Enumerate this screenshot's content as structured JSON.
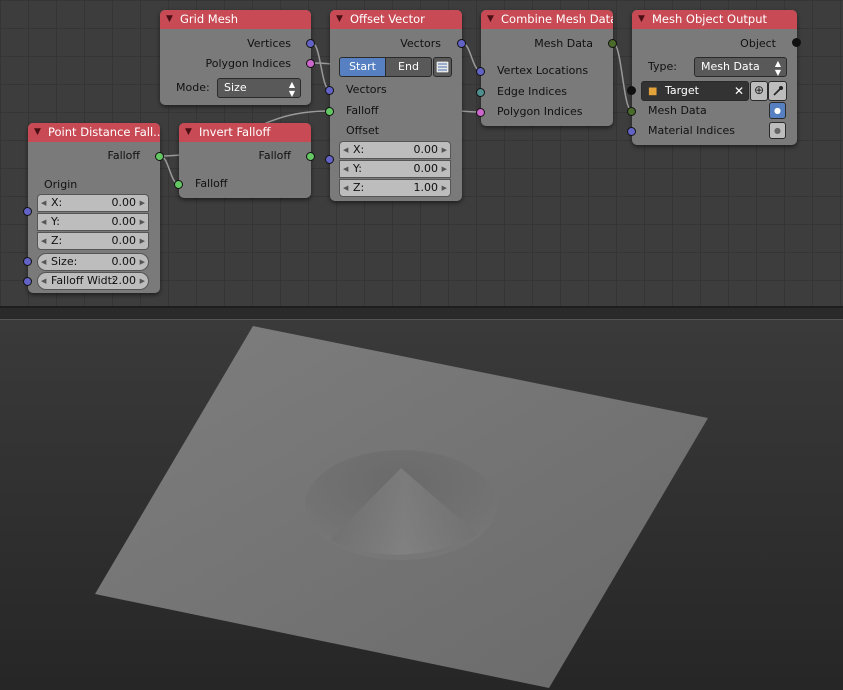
{
  "nodes": {
    "grid_mesh": {
      "title": "Grid Mesh",
      "outputs": [
        "Vertices",
        "Polygon Indices"
      ],
      "mode_label": "Mode:",
      "mode_value": "Size"
    },
    "offset_vector": {
      "title": "Offset Vector",
      "output": "Vectors",
      "start_label": "Start",
      "end_label": "End",
      "inputs": [
        "Vectors",
        "Falloff",
        "Offset"
      ],
      "offset": {
        "x_label": "X:",
        "x": "0.00",
        "y_label": "Y:",
        "y": "0.00",
        "z_label": "Z:",
        "z": "1.00"
      }
    },
    "combine_mesh": {
      "title": "Combine Mesh Data",
      "output": "Mesh Data",
      "inputs": [
        "Vertex Locations",
        "Edge Indices",
        "Polygon Indices"
      ]
    },
    "mesh_output": {
      "title": "Mesh Object Output",
      "output": "Object",
      "type_label": "Type:",
      "type_value": "Mesh Data",
      "target_name": "Target",
      "inputs": [
        "Mesh Data",
        "Material Indices"
      ]
    },
    "point_distance": {
      "title": "Point Distance Fall...",
      "output": "Falloff",
      "origin_label": "Origin",
      "origin": {
        "x_label": "X:",
        "x": "0.00",
        "y_label": "Y:",
        "y": "0.00",
        "z_label": "Z:",
        "z": "0.00"
      },
      "size_label": "Size:",
      "size": "0.00",
      "falloff_width_label": "Falloff Widt:",
      "falloff_width": "2.00"
    },
    "invert_falloff": {
      "title": "Invert Falloff",
      "output": "Falloff",
      "input": "Falloff"
    }
  },
  "icons": {
    "collapse": "triangle-down-icon",
    "list": "list-icon",
    "object": "cube-icon",
    "clear": "close-icon",
    "add": "plus-circle-icon",
    "picker": "eyedropper-icon"
  },
  "colors": {
    "header": "#c84a55",
    "node_body": "#7a7a7a",
    "vector_socket": "#6363c7",
    "float_socket": "#63c763",
    "polygon_socket": "#cc66cc",
    "mesh_socket": "#4a6b2a",
    "object_socket": "#111111",
    "active_button": "#5680c2"
  }
}
